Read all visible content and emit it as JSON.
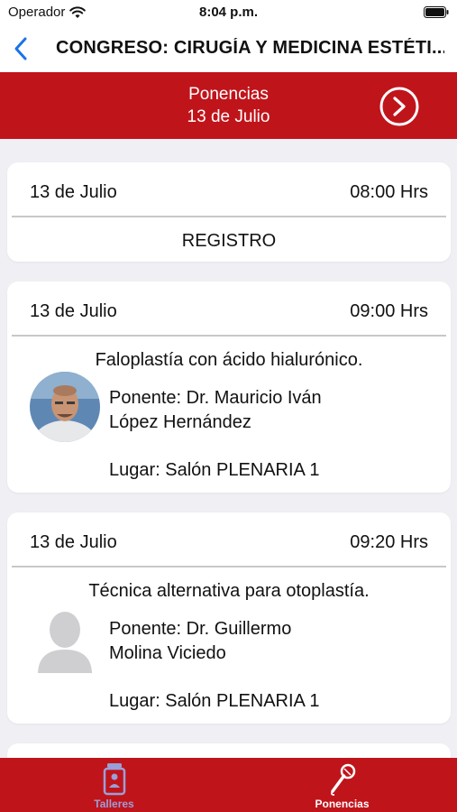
{
  "status": {
    "carrier": "Operador",
    "time": "8:04 p.m."
  },
  "nav": {
    "title": "CONGRESO: CIRUGÍA Y MEDICINA ESTÉTI..."
  },
  "banner": {
    "title": "Ponencias",
    "date": "13 de Julio"
  },
  "sessions": [
    {
      "date": "13 de Julio",
      "time": "08:00 Hrs",
      "title": "REGISTRO"
    },
    {
      "date": "13 de Julio",
      "time": "09:00 Hrs",
      "title": "Faloplastía con ácido hialurónico.",
      "speaker_line1": "Ponente: Dr. Mauricio Iván",
      "speaker_line2": "López Hernández",
      "place": "Lugar: Salón PLENARIA 1"
    },
    {
      "date": "13 de Julio",
      "time": "09:20 Hrs",
      "title": "Técnica alternativa para otoplastía.",
      "speaker_line1": "Ponente: Dr. Guillermo",
      "speaker_line2": "Molina Viciedo",
      "place": "Lugar: Salón PLENARIA 1"
    }
  ],
  "tabs": [
    {
      "label": "Talleres",
      "icon": "badge-icon",
      "active": false,
      "color": "#9a9fd8"
    },
    {
      "label": "Ponencias",
      "icon": "microphone-icon",
      "active": true,
      "color": "#ffffff"
    }
  ],
  "colors": {
    "brand": "#c0141b",
    "nav_accent": "#1a73e8"
  }
}
